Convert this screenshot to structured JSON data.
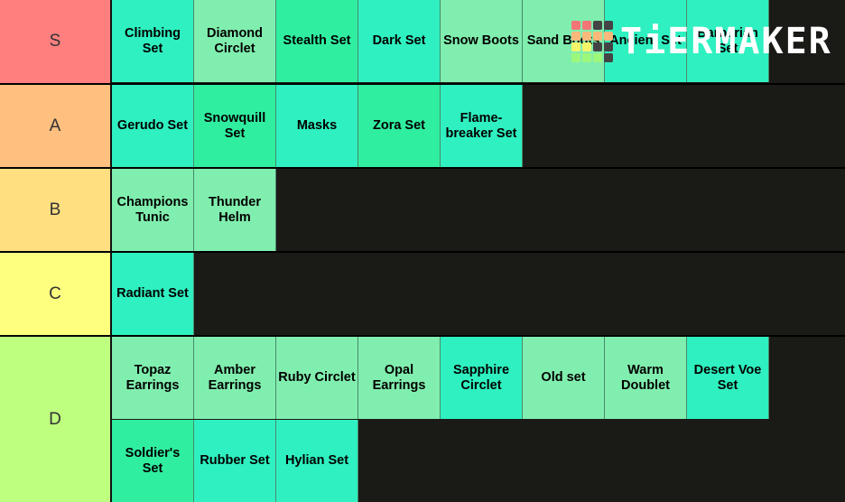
{
  "watermark": {
    "text": "TiERMAKER",
    "grid_colors": [
      "#f47575",
      "#f47575",
      "#444444",
      "#444444",
      "#f9b97a",
      "#f9b97a",
      "#f9b97a",
      "#f9b97a",
      "#f5f56a",
      "#f5f56a",
      "#444444",
      "#444444",
      "#9df77a",
      "#9df77a",
      "#9df77a",
      "#444444"
    ]
  },
  "colors": {
    "tier_S": "#ff7f7f",
    "tier_A": "#ffbf7f",
    "tier_B": "#ffdf80",
    "tier_C": "#ffff7f",
    "tier_D": "#bfff7f",
    "background": "#1a1a17"
  },
  "tiers": [
    {
      "label": "S",
      "items": [
        "Climbing Set",
        "Diamond Circlet",
        "Stealth Set",
        "Dark Set",
        "Snow Boots",
        "Sand Boots",
        "Ancient Set",
        "Barbarian Set"
      ]
    },
    {
      "label": "A",
      "items": [
        "Gerudo Set",
        "Snowquill Set",
        "Masks",
        "Zora Set",
        "Flame-breaker Set"
      ]
    },
    {
      "label": "B",
      "items": [
        "Champions Tunic",
        "Thunder Helm"
      ]
    },
    {
      "label": "C",
      "items": [
        "Radiant Set"
      ]
    },
    {
      "label": "D",
      "items": [
        "Topaz Earrings",
        "Amber Earrings",
        "Ruby Circlet",
        "Opal Earrings",
        "Sapphire Circlet",
        "Old set",
        "Warm Doublet",
        "Desert Voe Set",
        "Soldier's Set",
        "Rubber Set",
        "Hylian Set"
      ]
    }
  ]
}
